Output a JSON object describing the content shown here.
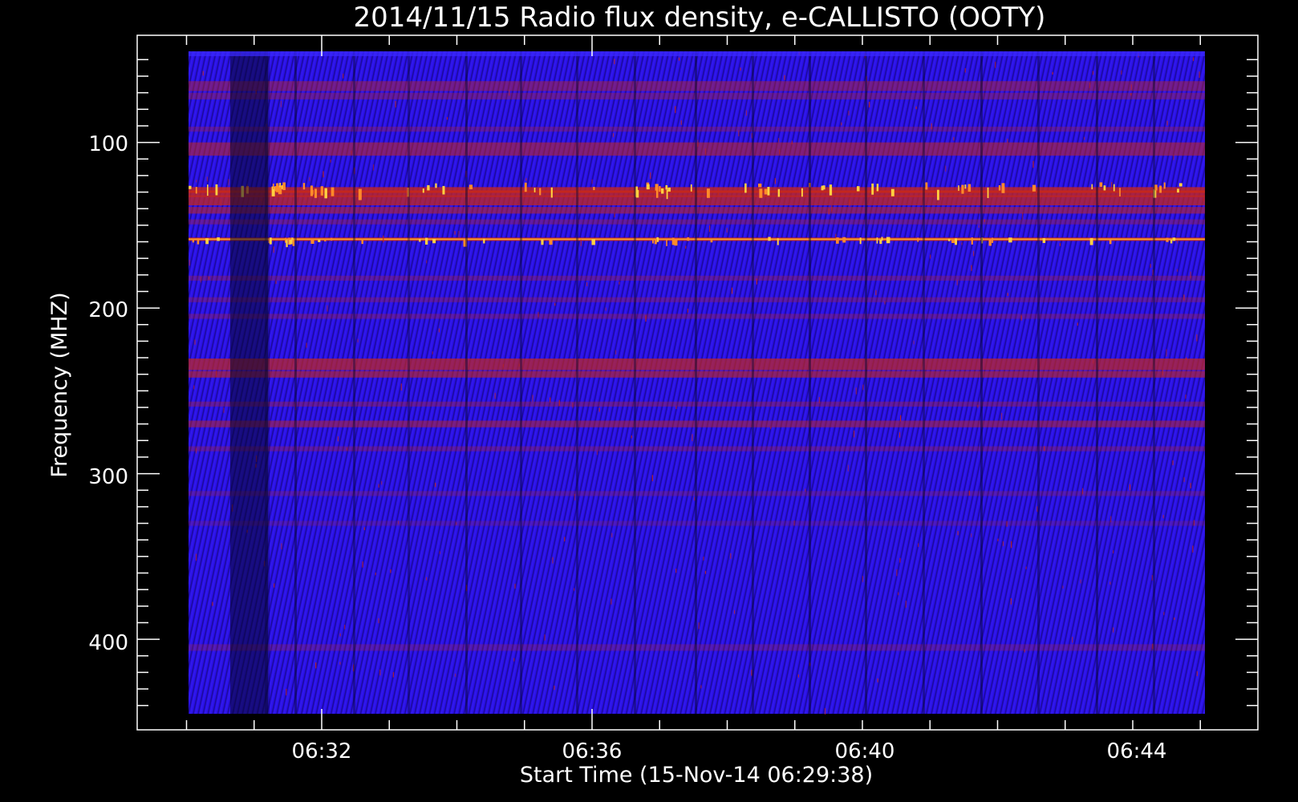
{
  "chart_data": {
    "type": "heatmap",
    "title": "2014/11/15  Radio flux density, e-CALLISTO (OOTY)",
    "xlabel": "Start Time (15-Nov-14 06:29:38)",
    "ylabel": "Frequency (MHZ)",
    "x_ticks": [
      "06:32",
      "06:36",
      "06:40",
      "06:44"
    ],
    "y_ticks": [
      "100",
      "200",
      "300",
      "400"
    ],
    "ylim": [
      45,
      445
    ],
    "y_inverted": true,
    "colormap": "blue-red-yellow",
    "features": {
      "bright_bands_mhz": [
        128,
        158
      ],
      "red_bands_mhz": [
        70,
        105,
        135,
        235,
        270
      ],
      "dark_column_time": "06:30:45"
    }
  },
  "colors": {
    "background": "#000000",
    "base": "#2a10e6",
    "red": "#c4261e",
    "yellow": "#ffd040",
    "axis": "#ffffff"
  }
}
